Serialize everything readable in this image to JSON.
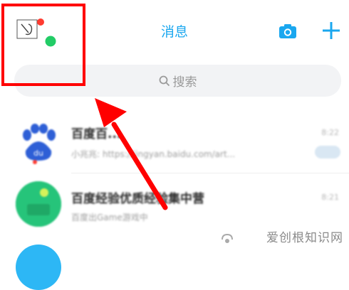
{
  "header": {
    "title": "消息",
    "camera_icon": "camera-icon",
    "plus_icon": "plus-icon"
  },
  "search": {
    "placeholder": "搜索"
  },
  "conversations": [
    {
      "name": "百度百...",
      "preview": "小兆兆: https://jingyan.baidu.com/art...",
      "time": "8:22"
    },
    {
      "name": "百度经验优质经验集中营",
      "preview": "百度出Game游戏中",
      "time": "8:21"
    }
  ],
  "watermark": {
    "text": "爱创根知识网"
  },
  "colors": {
    "accent": "#1aa7ef",
    "highlight": "#ff0000",
    "online_dot": "#22cc66",
    "alert_dot": "#ff3b30"
  }
}
